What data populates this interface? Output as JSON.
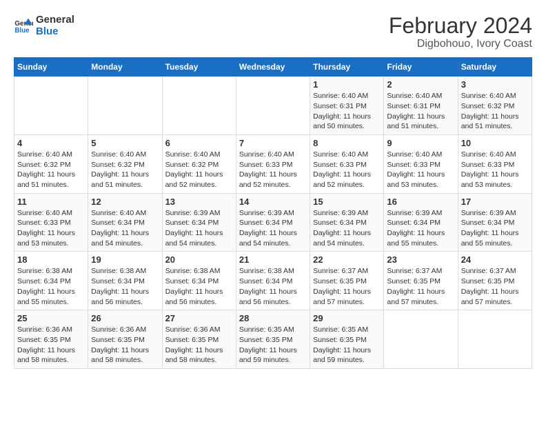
{
  "header": {
    "logo_line1": "General",
    "logo_line2": "Blue",
    "title": "February 2024",
    "subtitle": "Digbohouo, Ivory Coast"
  },
  "weekdays": [
    "Sunday",
    "Monday",
    "Tuesday",
    "Wednesday",
    "Thursday",
    "Friday",
    "Saturday"
  ],
  "weeks": [
    [
      {
        "day": "",
        "info": ""
      },
      {
        "day": "",
        "info": ""
      },
      {
        "day": "",
        "info": ""
      },
      {
        "day": "",
        "info": ""
      },
      {
        "day": "1",
        "info": "Sunrise: 6:40 AM\nSunset: 6:31 PM\nDaylight: 11 hours and 50 minutes."
      },
      {
        "day": "2",
        "info": "Sunrise: 6:40 AM\nSunset: 6:31 PM\nDaylight: 11 hours and 51 minutes."
      },
      {
        "day": "3",
        "info": "Sunrise: 6:40 AM\nSunset: 6:32 PM\nDaylight: 11 hours and 51 minutes."
      }
    ],
    [
      {
        "day": "4",
        "info": "Sunrise: 6:40 AM\nSunset: 6:32 PM\nDaylight: 11 hours and 51 minutes."
      },
      {
        "day": "5",
        "info": "Sunrise: 6:40 AM\nSunset: 6:32 PM\nDaylight: 11 hours and 51 minutes."
      },
      {
        "day": "6",
        "info": "Sunrise: 6:40 AM\nSunset: 6:32 PM\nDaylight: 11 hours and 52 minutes."
      },
      {
        "day": "7",
        "info": "Sunrise: 6:40 AM\nSunset: 6:33 PM\nDaylight: 11 hours and 52 minutes."
      },
      {
        "day": "8",
        "info": "Sunrise: 6:40 AM\nSunset: 6:33 PM\nDaylight: 11 hours and 52 minutes."
      },
      {
        "day": "9",
        "info": "Sunrise: 6:40 AM\nSunset: 6:33 PM\nDaylight: 11 hours and 53 minutes."
      },
      {
        "day": "10",
        "info": "Sunrise: 6:40 AM\nSunset: 6:33 PM\nDaylight: 11 hours and 53 minutes."
      }
    ],
    [
      {
        "day": "11",
        "info": "Sunrise: 6:40 AM\nSunset: 6:33 PM\nDaylight: 11 hours and 53 minutes."
      },
      {
        "day": "12",
        "info": "Sunrise: 6:40 AM\nSunset: 6:34 PM\nDaylight: 11 hours and 54 minutes."
      },
      {
        "day": "13",
        "info": "Sunrise: 6:39 AM\nSunset: 6:34 PM\nDaylight: 11 hours and 54 minutes."
      },
      {
        "day": "14",
        "info": "Sunrise: 6:39 AM\nSunset: 6:34 PM\nDaylight: 11 hours and 54 minutes."
      },
      {
        "day": "15",
        "info": "Sunrise: 6:39 AM\nSunset: 6:34 PM\nDaylight: 11 hours and 54 minutes."
      },
      {
        "day": "16",
        "info": "Sunrise: 6:39 AM\nSunset: 6:34 PM\nDaylight: 11 hours and 55 minutes."
      },
      {
        "day": "17",
        "info": "Sunrise: 6:39 AM\nSunset: 6:34 PM\nDaylight: 11 hours and 55 minutes."
      }
    ],
    [
      {
        "day": "18",
        "info": "Sunrise: 6:38 AM\nSunset: 6:34 PM\nDaylight: 11 hours and 55 minutes."
      },
      {
        "day": "19",
        "info": "Sunrise: 6:38 AM\nSunset: 6:34 PM\nDaylight: 11 hours and 56 minutes."
      },
      {
        "day": "20",
        "info": "Sunrise: 6:38 AM\nSunset: 6:34 PM\nDaylight: 11 hours and 56 minutes."
      },
      {
        "day": "21",
        "info": "Sunrise: 6:38 AM\nSunset: 6:34 PM\nDaylight: 11 hours and 56 minutes."
      },
      {
        "day": "22",
        "info": "Sunrise: 6:37 AM\nSunset: 6:35 PM\nDaylight: 11 hours and 57 minutes."
      },
      {
        "day": "23",
        "info": "Sunrise: 6:37 AM\nSunset: 6:35 PM\nDaylight: 11 hours and 57 minutes."
      },
      {
        "day": "24",
        "info": "Sunrise: 6:37 AM\nSunset: 6:35 PM\nDaylight: 11 hours and 57 minutes."
      }
    ],
    [
      {
        "day": "25",
        "info": "Sunrise: 6:36 AM\nSunset: 6:35 PM\nDaylight: 11 hours and 58 minutes."
      },
      {
        "day": "26",
        "info": "Sunrise: 6:36 AM\nSunset: 6:35 PM\nDaylight: 11 hours and 58 minutes."
      },
      {
        "day": "27",
        "info": "Sunrise: 6:36 AM\nSunset: 6:35 PM\nDaylight: 11 hours and 58 minutes."
      },
      {
        "day": "28",
        "info": "Sunrise: 6:35 AM\nSunset: 6:35 PM\nDaylight: 11 hours and 59 minutes."
      },
      {
        "day": "29",
        "info": "Sunrise: 6:35 AM\nSunset: 6:35 PM\nDaylight: 11 hours and 59 minutes."
      },
      {
        "day": "",
        "info": ""
      },
      {
        "day": "",
        "info": ""
      }
    ]
  ]
}
